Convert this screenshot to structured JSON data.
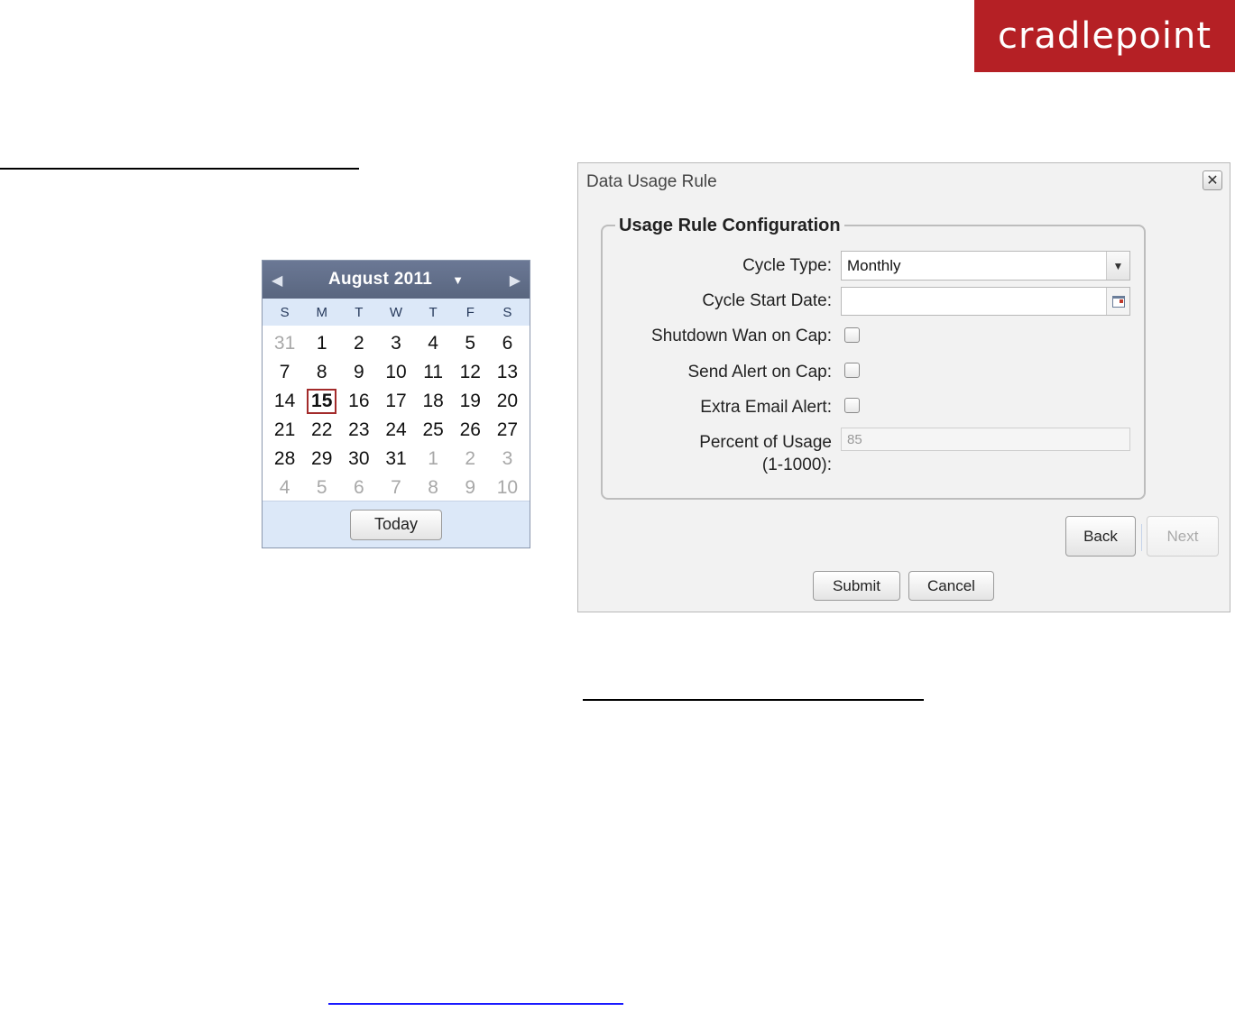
{
  "brand": {
    "logo_text": "cradlepoint"
  },
  "calendar": {
    "month_label": "August 2011",
    "days_of_week": [
      "S",
      "M",
      "T",
      "W",
      "T",
      "F",
      "S"
    ],
    "days": [
      {
        "d": "31",
        "other": true
      },
      {
        "d": "1"
      },
      {
        "d": "2"
      },
      {
        "d": "3"
      },
      {
        "d": "4"
      },
      {
        "d": "5"
      },
      {
        "d": "6"
      },
      {
        "d": "7"
      },
      {
        "d": "8"
      },
      {
        "d": "9"
      },
      {
        "d": "10"
      },
      {
        "d": "11"
      },
      {
        "d": "12"
      },
      {
        "d": "13"
      },
      {
        "d": "14"
      },
      {
        "d": "15",
        "selected": true
      },
      {
        "d": "16"
      },
      {
        "d": "17"
      },
      {
        "d": "18"
      },
      {
        "d": "19"
      },
      {
        "d": "20"
      },
      {
        "d": "21"
      },
      {
        "d": "22"
      },
      {
        "d": "23"
      },
      {
        "d": "24"
      },
      {
        "d": "25"
      },
      {
        "d": "26"
      },
      {
        "d": "27"
      },
      {
        "d": "28"
      },
      {
        "d": "29"
      },
      {
        "d": "30"
      },
      {
        "d": "31"
      },
      {
        "d": "1",
        "other": true
      },
      {
        "d": "2",
        "other": true
      },
      {
        "d": "3",
        "other": true
      },
      {
        "d": "4",
        "other": true
      },
      {
        "d": "5",
        "other": true
      },
      {
        "d": "6",
        "other": true
      },
      {
        "d": "7",
        "other": true
      },
      {
        "d": "8",
        "other": true
      },
      {
        "d": "9",
        "other": true
      },
      {
        "d": "10",
        "other": true
      }
    ],
    "today_label": "Today"
  },
  "dialog": {
    "title": "Data Usage Rule",
    "close_glyph": "✕",
    "legend": "Usage Rule Configuration",
    "cycle_type_label": "Cycle Type:",
    "cycle_type_value": "Monthly",
    "cycle_start_label": "Cycle Start Date:",
    "cycle_start_value": "",
    "shutdown_label": "Shutdown Wan on Cap:",
    "send_alert_label": "Send Alert on Cap:",
    "extra_email_label": "Extra Email Alert:",
    "percent_label_line1": "Percent of Usage",
    "percent_label_line2": "(1-1000):",
    "percent_value": "85",
    "back_label": "Back",
    "next_label": "Next",
    "submit_label": "Submit",
    "cancel_label": "Cancel"
  }
}
